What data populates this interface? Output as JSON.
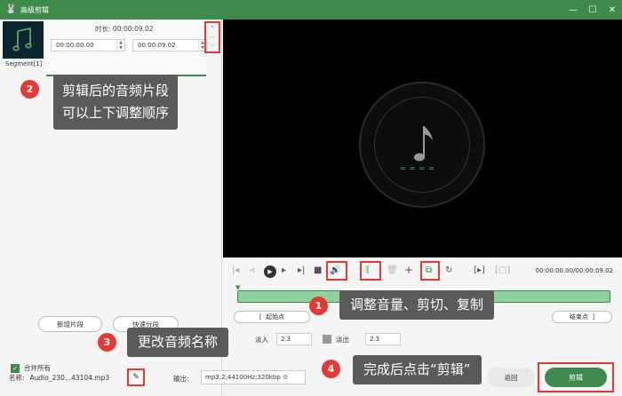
{
  "window": {
    "title": "高级剪辑",
    "app_icon": "rabbit-icon",
    "controls": [
      "minimize-icon",
      "maximize-icon",
      "close-icon"
    ]
  },
  "segment": {
    "label": "Segment[1]",
    "duration_label": "时长:",
    "duration_value": "00:00:09.02",
    "start_time": "00:00:00.00",
    "end_time": "00:00:09.02",
    "dash": "-"
  },
  "left_panel": {
    "add_segment": "新增片段",
    "quick_split": "快速分段",
    "merge_all": "合并所有"
  },
  "toolbar": {
    "time_display": "00:00:00.00/00:00:09.02",
    "volume_icon": "volume-icon",
    "cut_icon": "cut-icon",
    "copy_icon": "copy-icon"
  },
  "timeline": {
    "start_point": "起始点",
    "end_point": "结束点",
    "fade_in_label": "淡入",
    "fade_in_value": "2.3",
    "fade_out_label": "淡出",
    "fade_out_value": "2.3"
  },
  "bottom": {
    "name_label": "名称:",
    "name_value": "Audio_230...43104.mp3",
    "output_label": "输出:",
    "output_value": "mp3;2;44100Hz;320kbp",
    "back_button": "返回",
    "edit_button": "剪辑"
  },
  "annotations": [
    {
      "number": "1",
      "text": "调整音量、剪切、复制"
    },
    {
      "number": "2",
      "text_line1": "剪辑后的音频片段",
      "text_line2": "可以上下调整顺序"
    },
    {
      "number": "3",
      "text": "更改音频名称"
    },
    {
      "number": "4",
      "text": "完成后点击“剪辑”"
    }
  ],
  "colors": {
    "accent": "#3d8a4c",
    "highlight": "#e53935",
    "callout_bg": "#5a5a5a",
    "waveform": "#8fd19c"
  }
}
